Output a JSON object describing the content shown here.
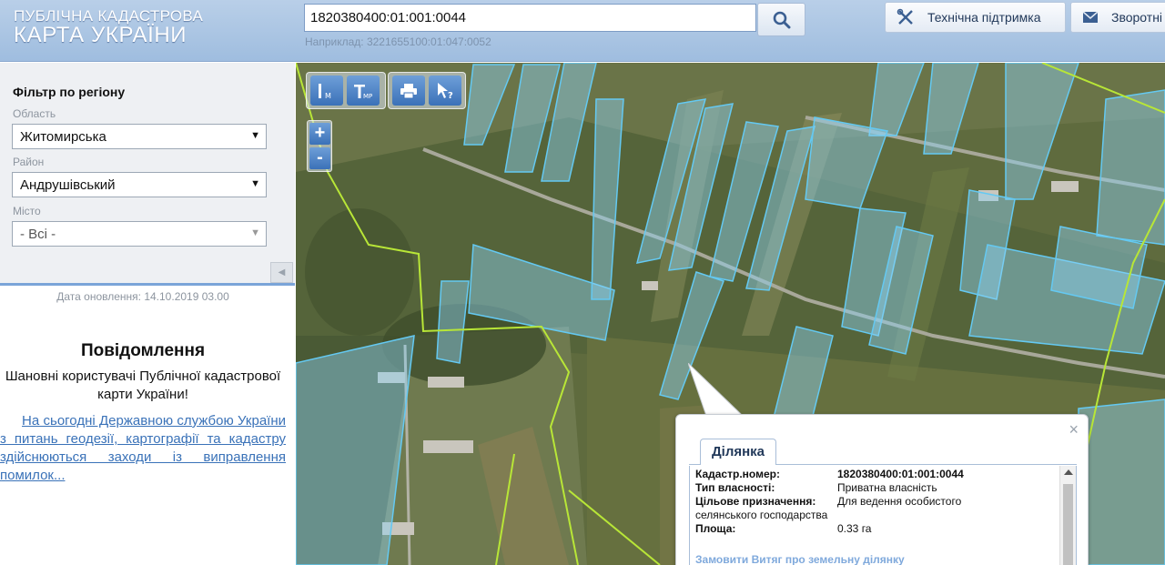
{
  "header": {
    "logo_line1": "ПУБЛІЧНА КАДАСТРОВА",
    "logo_line2": "КАРТА УКРАЇНИ",
    "search_value": "1820380400:01:001:0044",
    "search_example": "Наприклад: 3221655100:01:047:0052",
    "support_label": "Технічна підтримка",
    "feedback_label": "Зворотні"
  },
  "sidebar": {
    "filter_title": "Фільтр по регіону",
    "region_label": "Область",
    "region_value": "Житомирська",
    "district_label": "Район",
    "district_value": "Андрушівський",
    "city_label": "Місто",
    "city_value": "- Всі -",
    "updated": "Дата оновлення: 14.10.2019 03.00",
    "notice_title": "Повідомлення",
    "notice_text": "Шановні користувачі Публічної кадастрової карти України!",
    "notice_link": "На сьогодні Державною службою України з питань геодезії, картографії та кадастру здійснюються заходи із виправлення помилок..."
  },
  "map": {
    "zoom_in": "+",
    "zoom_out": "-",
    "tools": [
      "ruler-meters-icon",
      "ruler-area-icon",
      "print-icon",
      "identify-icon"
    ]
  },
  "popup": {
    "tab_label": "Ділянка",
    "close_label": "×",
    "rows": [
      {
        "key": "Кадастр.номер:",
        "value": "1820380400:01:001:0044"
      },
      {
        "key": "Тип власності:",
        "value": "Приватна власність"
      },
      {
        "key": "Цільове призначення:",
        "value": "Для ведення особистого селянського господарства"
      },
      {
        "key": "Площа:",
        "value": "0.33 га"
      }
    ],
    "extract_link": "Замовити Витяг про земельну ділянку"
  },
  "colors": {
    "header_bg": "#a9c4e4",
    "accent": "#3b71b8",
    "parcel_outline": "#5ec8f4",
    "boundary_line": "#b8e637"
  }
}
